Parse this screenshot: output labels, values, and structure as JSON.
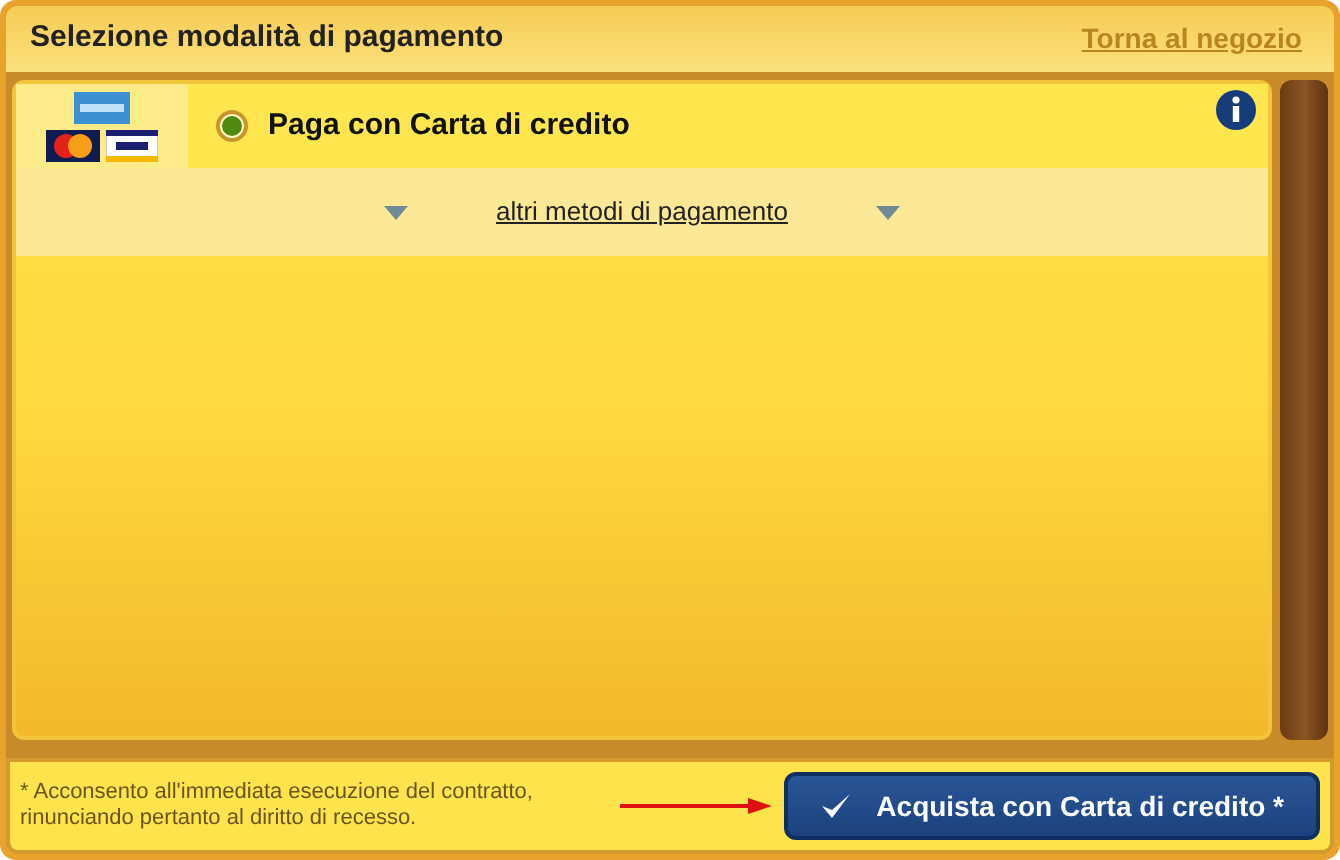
{
  "header": {
    "title": "Selezione modalità di pagamento",
    "back_link": "Torna al negozio"
  },
  "methods": [
    {
      "label": "Paga con Carta di credito",
      "selected": true
    }
  ],
  "other_methods": "altri metodi di pagamento",
  "footer": {
    "consent": "* Acconsento all'immediata esecuzione del contratto, rinunciando pertanto al diritto di recesso.",
    "buy_button": "Acquista con Carta di credito *"
  }
}
